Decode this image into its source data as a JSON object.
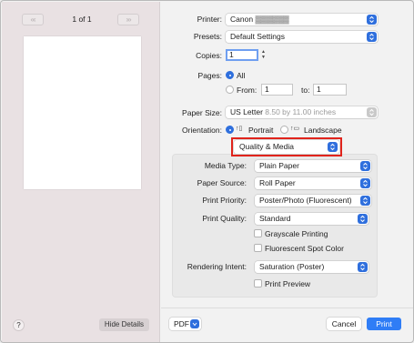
{
  "preview": {
    "prev_first": "«",
    "prev": "‹",
    "page_counter": "1 of 1",
    "next": "›",
    "next_last": "»",
    "help": "?",
    "hide_details": "Hide Details"
  },
  "printer": {
    "label": "Printer:",
    "value": "Canon"
  },
  "presets": {
    "label": "Presets:",
    "value": "Default Settings"
  },
  "copies": {
    "label": "Copies:",
    "value": "1"
  },
  "pages": {
    "label": "Pages:",
    "all_label": "All",
    "from_label": "From:",
    "from_value": "1",
    "to_label": "to:",
    "to_value": "1",
    "selected": "All"
  },
  "paper_size": {
    "label": "Paper Size:",
    "value": "US Letter",
    "detail": "8.50 by 11.00 inches"
  },
  "orientation": {
    "label": "Orientation:",
    "portrait_label": "Portrait",
    "landscape_label": "Landscape",
    "selected": "Portrait"
  },
  "section_menu": {
    "value": "Quality & Media"
  },
  "media_type": {
    "label": "Media Type:",
    "value": "Plain Paper"
  },
  "paper_source": {
    "label": "Paper Source:",
    "value": "Roll Paper"
  },
  "print_priority": {
    "label": "Print Priority:",
    "value": "Poster/Photo (Fluorescent)"
  },
  "print_quality": {
    "label": "Print Quality:",
    "value": "Standard"
  },
  "grayscale": {
    "label": "Grayscale Printing",
    "checked": false
  },
  "fluorescent": {
    "label": "Fluorescent Spot Color",
    "checked": false
  },
  "rendering_intent": {
    "label": "Rendering Intent:",
    "value": "Saturation (Poster)"
  },
  "print_preview": {
    "label": "Print Preview",
    "checked": false
  },
  "footer": {
    "pdf": "PDF",
    "cancel": "Cancel",
    "print": "Print"
  },
  "colors": {
    "accent": "#2f6fdd",
    "print_button": "#2f7df6",
    "highlight": "#e0241c",
    "preview_bg": "#e9e1e3"
  }
}
